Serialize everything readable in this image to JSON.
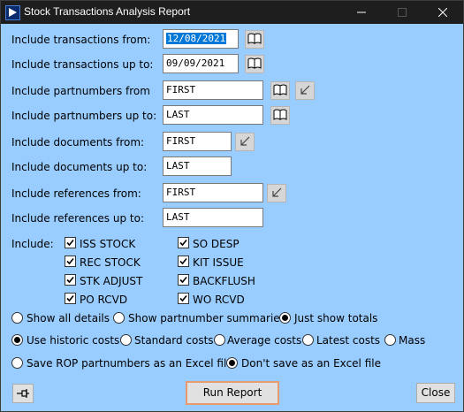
{
  "window": {
    "title": "Stock Transactions Analysis Report"
  },
  "fields": {
    "trans_from_label": "Include transactions from:",
    "trans_from_value": "12/08/2021",
    "trans_to_label": "Include transactions up to:",
    "trans_to_value": "09/09/2021",
    "part_from_label": "Include partnumbers from",
    "part_from_value": "FIRST",
    "part_to_label": "Include partnumbers up to:",
    "part_to_value": "LAST",
    "doc_from_label": "Include documents from:",
    "doc_from_value": "FIRST",
    "doc_to_label": "Include documents up to:",
    "doc_to_value": "LAST",
    "ref_from_label": "Include references from:",
    "ref_from_value": "FIRST",
    "ref_to_label": "Include references up to:",
    "ref_to_value": "LAST"
  },
  "include": {
    "label": "Include:",
    "items": [
      {
        "label": "ISS STOCK",
        "checked": true
      },
      {
        "label": "REC STOCK",
        "checked": true
      },
      {
        "label": "STK ADJUST",
        "checked": true
      },
      {
        "label": "PO RCVD",
        "checked": true
      },
      {
        "label": "SO DESP",
        "checked": true
      },
      {
        "label": "KIT ISSUE",
        "checked": true
      },
      {
        "label": "BACKFLUSH",
        "checked": true
      },
      {
        "label": "WO RCVD",
        "checked": true
      }
    ]
  },
  "detail_options": [
    {
      "label": "Show all details",
      "selected": false
    },
    {
      "label": "Show partnumber summaries",
      "selected": false
    },
    {
      "label": "Just show totals",
      "selected": true
    }
  ],
  "cost_options": [
    {
      "label": "Use historic costs",
      "selected": true
    },
    {
      "label": "Standard costs",
      "selected": false
    },
    {
      "label": "Average costs",
      "selected": false
    },
    {
      "label": "Latest costs",
      "selected": false
    },
    {
      "label": "Mass",
      "selected": false
    }
  ],
  "excel_options": [
    {
      "label": "Save ROP partnumbers as an Excel file",
      "selected": false
    },
    {
      "label": "Don't save as an Excel file",
      "selected": true
    }
  ],
  "buttons": {
    "run_report": "Run Report",
    "close": "Close"
  },
  "icons": {
    "title": "app-play-icon",
    "lookup": "book-lookup-icon",
    "arrow": "arrow-down-left-icon",
    "pin": "pin-icon"
  },
  "colors": {
    "background": "#99ccff",
    "titlebar": "#1e1e1e",
    "selection": "#0078d7"
  }
}
